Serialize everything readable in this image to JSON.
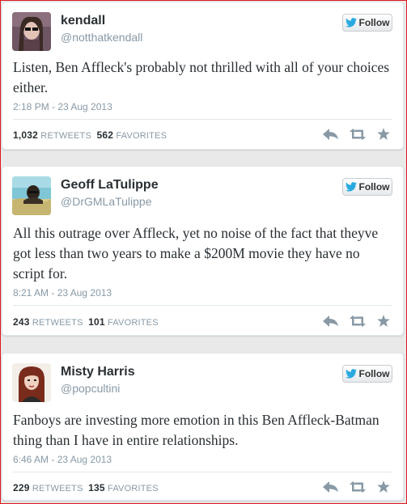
{
  "follow_label": "Follow",
  "tweets": [
    {
      "name": "kendall",
      "handle": "@notthatkendall",
      "text": "Listen, Ben Affleck's probably not thrilled with all of your choices either.",
      "timestamp": "2:18 PM - 23 Aug 2013",
      "retweets": "1,032",
      "retweets_label": "RETWEETS",
      "favorites": "562",
      "favorites_label": "FAVORITES"
    },
    {
      "name": "Geoff LaTulippe",
      "handle": "@DrGMLaTulippe",
      "text": "All this outrage over Affleck, yet no noise of the fact that theyve got less than two years to make a $200M movie they have no script for.",
      "timestamp": "8:21 AM - 23 Aug 2013",
      "retweets": "243",
      "retweets_label": "RETWEETS",
      "favorites": "101",
      "favorites_label": "FAVORITES"
    },
    {
      "name": "Misty Harris",
      "handle": "@popcultini",
      "text": "Fanboys are investing more emotion in this Ben Affleck-Batman thing than I have in entire relationships.",
      "timestamp": "6:46 AM - 23 Aug 2013",
      "retweets": "229",
      "retweets_label": "RETWEETS",
      "favorites": "135",
      "favorites_label": "FAVORITES"
    }
  ],
  "colors": {
    "twitter_blue": "#2aa9e0",
    "action_gray": "#8899a6",
    "frame_red": "#e0161b"
  },
  "icons": [
    "twitter-bird-icon",
    "reply-icon",
    "retweet-icon",
    "favorite-star-icon"
  ]
}
